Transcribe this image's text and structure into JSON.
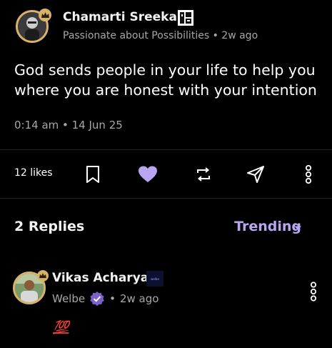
{
  "post": {
    "author_name": "Chamarti Sreekar",
    "author_tagline": "Passionate about Possibilities",
    "separator": "•",
    "posted_ago": "2w ago",
    "text": "God sends people in your life to help you where you are honest with your intention",
    "timestamp": "0:14 am • 14 Jun 25"
  },
  "actions": {
    "likes_label": "12 likes",
    "icons": [
      "bookmark-icon",
      "heart-icon",
      "repost-icon",
      "send-icon",
      "more-vertical-icon"
    ]
  },
  "replies": {
    "title": "2 Replies",
    "sort_label": "Trending",
    "items": [
      {
        "author_name": "Vikas Acharya",
        "badge_text": "welbe",
        "community": "Welbe",
        "posted_ago": "2w ago",
        "separator": "•",
        "text": "💯"
      }
    ]
  },
  "colors": {
    "background": "#000000",
    "accent": "#b9a6f2",
    "gold_ring": "#d9b26a",
    "muted_text": "#a7a7a7",
    "divider": "#242424"
  }
}
